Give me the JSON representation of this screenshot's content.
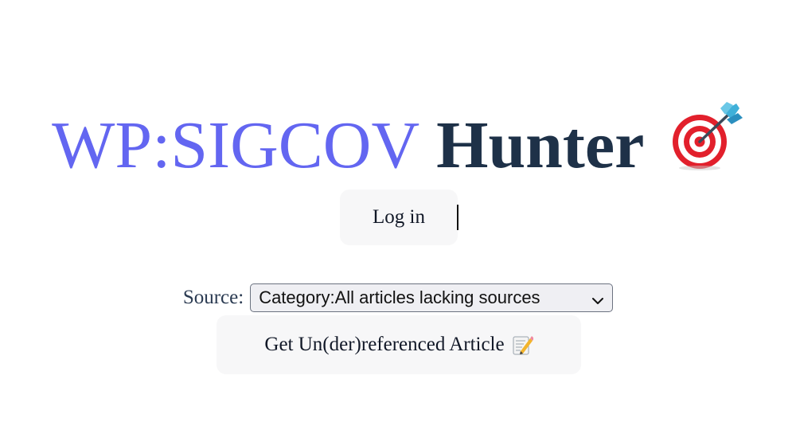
{
  "header": {
    "title_accent": "WP:SIGCOV",
    "title_main": "Hunter",
    "title_icon": "direct-hit-target-icon",
    "accent_color": "#6366f1",
    "main_color": "#1e3148"
  },
  "auth": {
    "login_label": "Log in"
  },
  "source": {
    "label": "Source:",
    "selected": "Category:All articles lacking sources"
  },
  "actions": {
    "get_article_label": "Get Un(der)referenced Article",
    "get_article_icon": "memo-icon"
  }
}
